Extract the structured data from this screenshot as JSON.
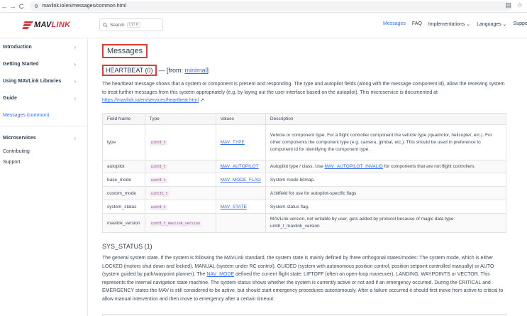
{
  "browser": {
    "url": "mavlink.io/en/messages/common.html",
    "back": "←",
    "forward": "→",
    "reload": "C",
    "tune": "⚙",
    "translate": "▤",
    "star": "☆"
  },
  "header": {
    "logo_prefix": "MAV",
    "logo_suffix": "LINK",
    "search_label": "Search",
    "search_kbd": "Ctrl K",
    "nav": [
      "Messages",
      "FAQ",
      "Implementations ⌄",
      "Languages ⌄",
      "Suppo"
    ]
  },
  "sidebar": {
    "items": [
      {
        "label": "Introduction",
        "chevron": "›"
      },
      {
        "label": "Getting Started",
        "chevron": "›"
      },
      {
        "label": "Using MAVLink Libraries",
        "chevron": "›"
      },
      {
        "label": "Guide",
        "chevron": "›"
      },
      {
        "label": "Messages (common)",
        "chevron": ""
      },
      {
        "label": "Microservices",
        "chevron": "›"
      },
      {
        "label": "Contributing",
        "chevron": ""
      },
      {
        "label": "Support",
        "chevron": ""
      }
    ]
  },
  "main": {
    "title": "Messages",
    "heartbeat": {
      "heading": "HEARTBEAT (0)",
      "from_prefix": "— [from: ",
      "from_link": "minimal",
      "from_suffix": "]",
      "desc": "The heartbeat message shows that a system or component is present and responding. The type and autopilot fields (along with the message component id), allow the receiving system to treat further messages from this system appropriately (e.g. by laying out the user interface based on the autopilot). This microservice is documented at ",
      "desc_link": "https://mavlink.io/en/services/heartbeat.html",
      "desc_link_icon": "↗"
    },
    "table": {
      "headers": [
        "Field Name",
        "Type",
        "Values",
        "Description"
      ],
      "rows": [
        {
          "name": "type",
          "type": "uint8_t",
          "value": "MAV_TYPE",
          "desc": "Vehicle or component type. For a flight controller component the vehicle type (quadrotor, helicopter, etc.). For other components the component type (e.g. camera, gimbal, etc.). This should be used in preference to component id for identifying the component type."
        },
        {
          "name": "autopilot",
          "type": "uint8_t",
          "value": "MAV_AUTOPILOT",
          "desc_pre": "Autopilot type / class. Use ",
          "desc_link": "MAV_AUTOPILOT_INVALID",
          "desc_post": " for components that are not flight controllers."
        },
        {
          "name": "base_mode",
          "type": "uint8_t",
          "value": "MAV_MODE_FLAG",
          "desc": "System mode bitmap."
        },
        {
          "name": "custom_mode",
          "type": "uint32_t",
          "value": "",
          "desc": "A bitfield for use for autopilot-specific flags"
        },
        {
          "name": "system_status",
          "type": "uint8_t",
          "value": "MAV_STATE",
          "desc": "System status flag."
        },
        {
          "name": "mavlink_version",
          "type": "uint8_t_mavlink_version",
          "value": "",
          "desc": "MAVLink version, not writable by user, gets added by protocol because of magic data type: uint8_t_mavlink_version"
        }
      ]
    },
    "sys_status": {
      "heading": "SYS_STATUS (1)",
      "desc_pre": "The general system state. If the system is following the MAVLink standard, the system state is mainly defined by three orthogonal states/modes: The system mode, which is either LOCKED (motors shut down and locked), MANUAL (system under RC control), GUIDED (system with autonomous position control, position setpoint controlled manually) or AUTO (system guided by path/waypoint planner). The ",
      "desc_link": "NAV_MODE",
      "desc_post": " defined the current flight state: LIFTOFF (often an open-loop maneuver), LANDING, WAYPOINTS or VECTOR. This represents the internal navigation state machine. The system status shows whether the system is currently active or not and if an emergency occurred. During the CRITICAL and EMERGENCY states the MAV is still considered to be active, but should start emergency procedures autonomously. After a failure occurred it should first move from active to critical to allow manual intervention and then move to emergency after a certain timeout."
    }
  }
}
